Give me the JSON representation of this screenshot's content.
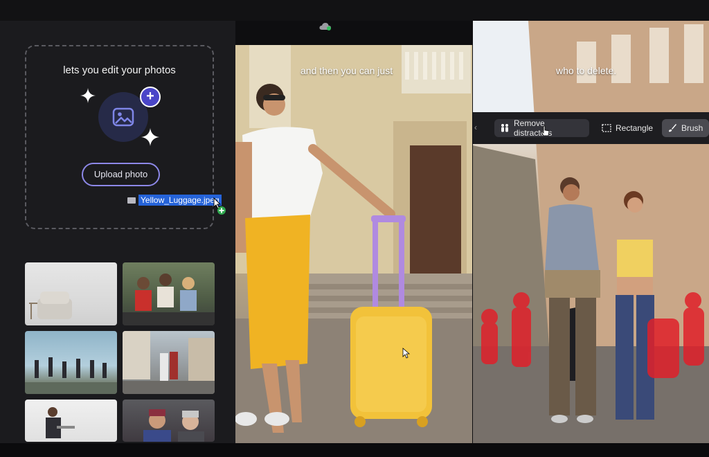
{
  "upload_panel": {
    "title": "lets you edit your photos",
    "upload_button_label": "Upload photo",
    "dragged_file_name": "Yellow_Luggage.jpeg"
  },
  "captions": {
    "left": "and then you can just",
    "right": "who to delete."
  },
  "toolbar": {
    "remove_distractors_label": "Remove distractors",
    "rectangle_label": "Rectangle",
    "brush_label": "Brush"
  },
  "icons": {
    "cloud": "cloud-sync-icon",
    "photo": "photo-icon",
    "plus": "plus-icon",
    "sparkle": "sparkle-icon",
    "people": "people-icon",
    "rectangle": "rectangle-select-icon",
    "brush": "brush-icon"
  },
  "colors": {
    "accent_purple": "#8d88e8",
    "badge_purple": "#4a46c8",
    "selection_blue": "#2563d9",
    "distractor_red": "#e0202a",
    "luggage_yellow": "#f2c23a",
    "handle_purple": "#b08ae0"
  }
}
